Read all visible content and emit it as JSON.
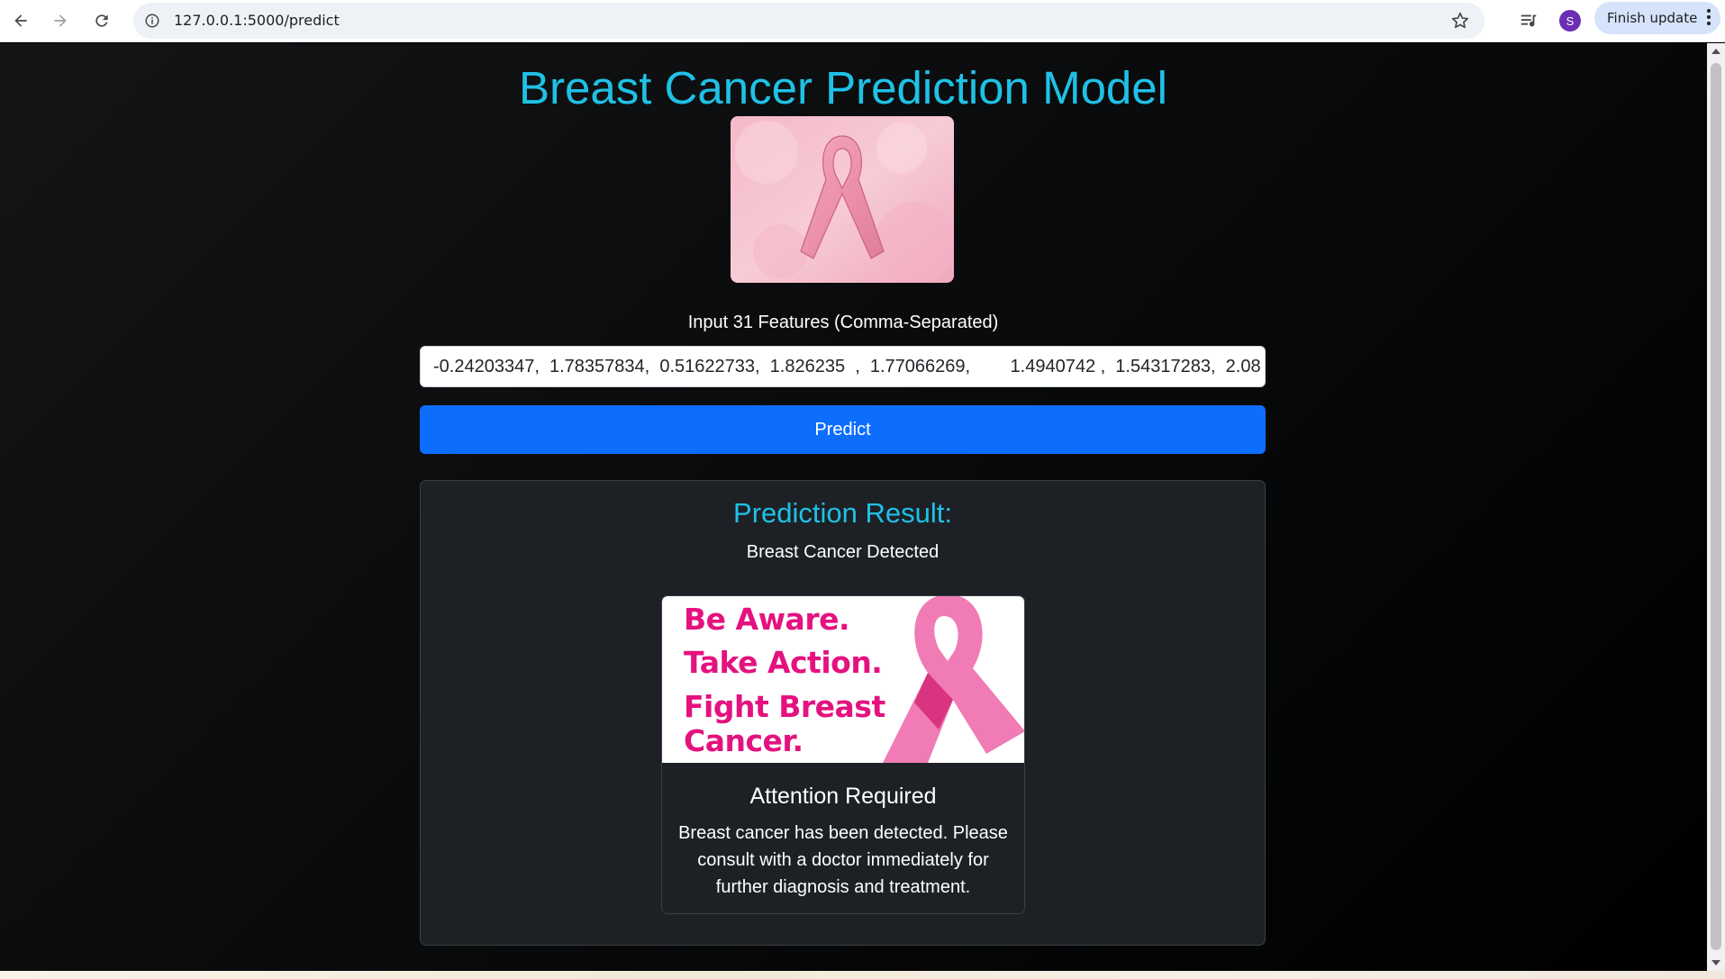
{
  "browser": {
    "url": "127.0.0.1:5000/predict",
    "profile_initial": "S",
    "update_label": "Finish update"
  },
  "page": {
    "title": "Breast Cancer Prediction Model",
    "input_label": "Input 31 Features (Comma-Separated)",
    "input_value": "-0.24203347,  1.78357834,  0.51622733,  1.826235  ,  1.77066269,        1.4940742 ,  1.54317283,  2.08",
    "predict_label": "Predict"
  },
  "result": {
    "heading": "Prediction Result:",
    "text": "Breast Cancer Detected",
    "banner_lines": [
      "Be Aware.",
      "Take Action.",
      "Fight Breast",
      "Cancer."
    ],
    "card_title": "Attention Required",
    "card_text": "Breast cancer has been detected. Please consult with a doctor immediately for further diagnosis and treatment."
  },
  "colors": {
    "accent": "#1fc1e6",
    "button": "#0d6efd",
    "pink": "#e4127f"
  }
}
